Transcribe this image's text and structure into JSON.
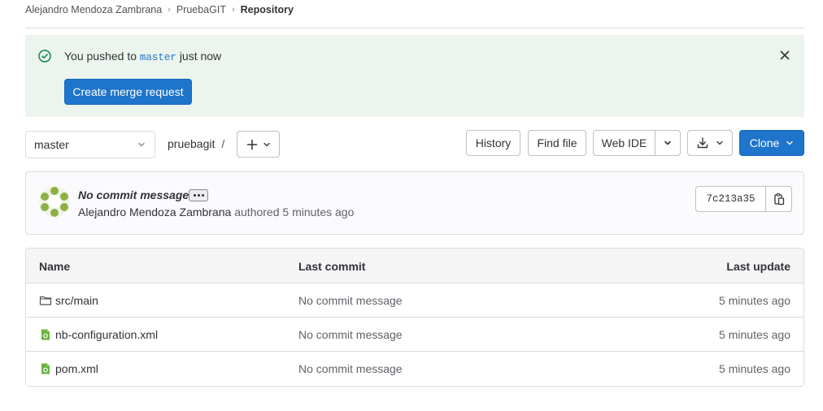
{
  "breadcrumb": {
    "items": [
      "Alejandro Mendoza Zambrana",
      "PruebaGIT"
    ],
    "current": "Repository",
    "separator": "›"
  },
  "alert": {
    "prefix": "You pushed to",
    "branch": "master",
    "suffix": "just now",
    "action_label": "Create merge request"
  },
  "toolbar": {
    "branch_selected": "master",
    "path": "pruebagit",
    "path_separator": "/",
    "history_label": "History",
    "find_file_label": "Find file",
    "web_ide_label": "Web IDE",
    "clone_label": "Clone"
  },
  "last_commit": {
    "title": "No commit message",
    "author": "Alejandro Mendoza Zambrana",
    "authored_text": "authored",
    "time": "5 minutes ago",
    "sha": "7c213a35"
  },
  "file_tree": {
    "columns": [
      "Name",
      "Last commit",
      "Last update"
    ],
    "rows": [
      {
        "name": "src/main",
        "type": "folder",
        "last_commit": "No commit message",
        "last_update": "5 minutes ago"
      },
      {
        "name": "nb-configuration.xml",
        "type": "file",
        "last_commit": "No commit message",
        "last_update": "5 minutes ago"
      },
      {
        "name": "pom.xml",
        "type": "file",
        "last_commit": "No commit message",
        "last_update": "5 minutes ago"
      }
    ]
  },
  "colors": {
    "primary": "#1f75cb",
    "success_bg": "#ecf4ee",
    "success_icon": "#108548",
    "file_icon": "#6cb33e"
  },
  "icons": {
    "alert": "check-circle-icon",
    "close": "close-icon",
    "folder": "folder-icon",
    "file": "file-xml-icon",
    "copy": "copy-to-clipboard-icon",
    "download": "download-icon",
    "chevron": "chevron-down-icon",
    "plus": "plus-icon"
  }
}
